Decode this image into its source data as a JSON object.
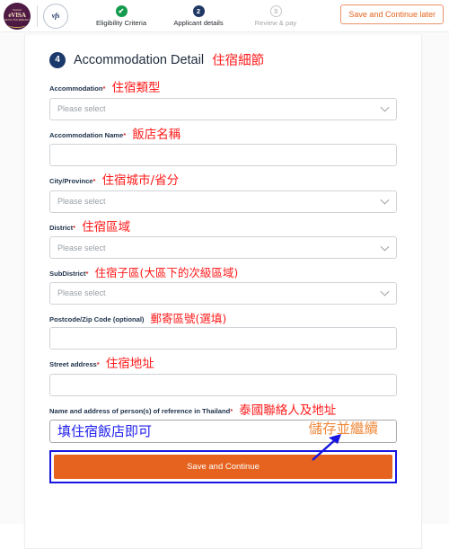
{
  "header": {
    "evisa_logo": {
      "top_text": "Thailand",
      "main_text": "eVISA",
      "sub_text": "ROYAL THAI EMBASSY"
    },
    "vfs_logo_text": "vfs",
    "steps": [
      {
        "badge": "✔",
        "label": "Eligibility Criteria",
        "state": "done"
      },
      {
        "badge": "2",
        "label": "Applicant details",
        "state": "active"
      },
      {
        "badge": "3",
        "label": "Review & pay",
        "state": "todo"
      }
    ],
    "save_later_label": "Save and Continue later"
  },
  "section": {
    "number": "4",
    "title": "Accommodation Detail",
    "annotation": "住宿細節"
  },
  "fields": [
    {
      "label": "Accommodation",
      "required": true,
      "annotation": "住宿類型",
      "type": "select",
      "value": "",
      "placeholder": "Please select"
    },
    {
      "label": "Accommodation Name",
      "required": true,
      "annotation": "飯店名稱",
      "type": "text",
      "value": "",
      "placeholder": ""
    },
    {
      "label": "City/Province",
      "required": true,
      "annotation": "住宿城市/省分",
      "type": "select",
      "value": "",
      "placeholder": "Please select"
    },
    {
      "label": "District",
      "required": true,
      "annotation": "住宿區域",
      "type": "select",
      "value": "",
      "placeholder": "Please select"
    },
    {
      "label": "SubDistrict",
      "required": true,
      "annotation": "住宿子區(大區下的次級區域)",
      "type": "select",
      "value": "",
      "placeholder": "Please select"
    },
    {
      "label": "Postcode/Zip Code (optional)",
      "required": false,
      "annotation": "郵寄區號(選填)",
      "type": "text",
      "value": "",
      "placeholder": ""
    },
    {
      "label": "Street address",
      "required": true,
      "annotation": "住宿地址",
      "type": "text",
      "value": "",
      "placeholder": ""
    }
  ],
  "reference": {
    "label": "Name and address of person(s) of reference in Thailand",
    "required": true,
    "annotation": "泰國聯絡人及地址",
    "input_annotation_blue": "填住宿飯店即可",
    "input_annotation_orange": "儲存並繼續",
    "value": ""
  },
  "submit": {
    "label": "Save and Continue"
  },
  "colors": {
    "orange": "#e5631f",
    "orange_light": "#f08a3c",
    "navy": "#1b3a6b",
    "green": "#149b4e",
    "annotation_red": "#ff1a1a",
    "annotation_blue": "#2222ee",
    "highlight_blue": "#1616e0"
  }
}
